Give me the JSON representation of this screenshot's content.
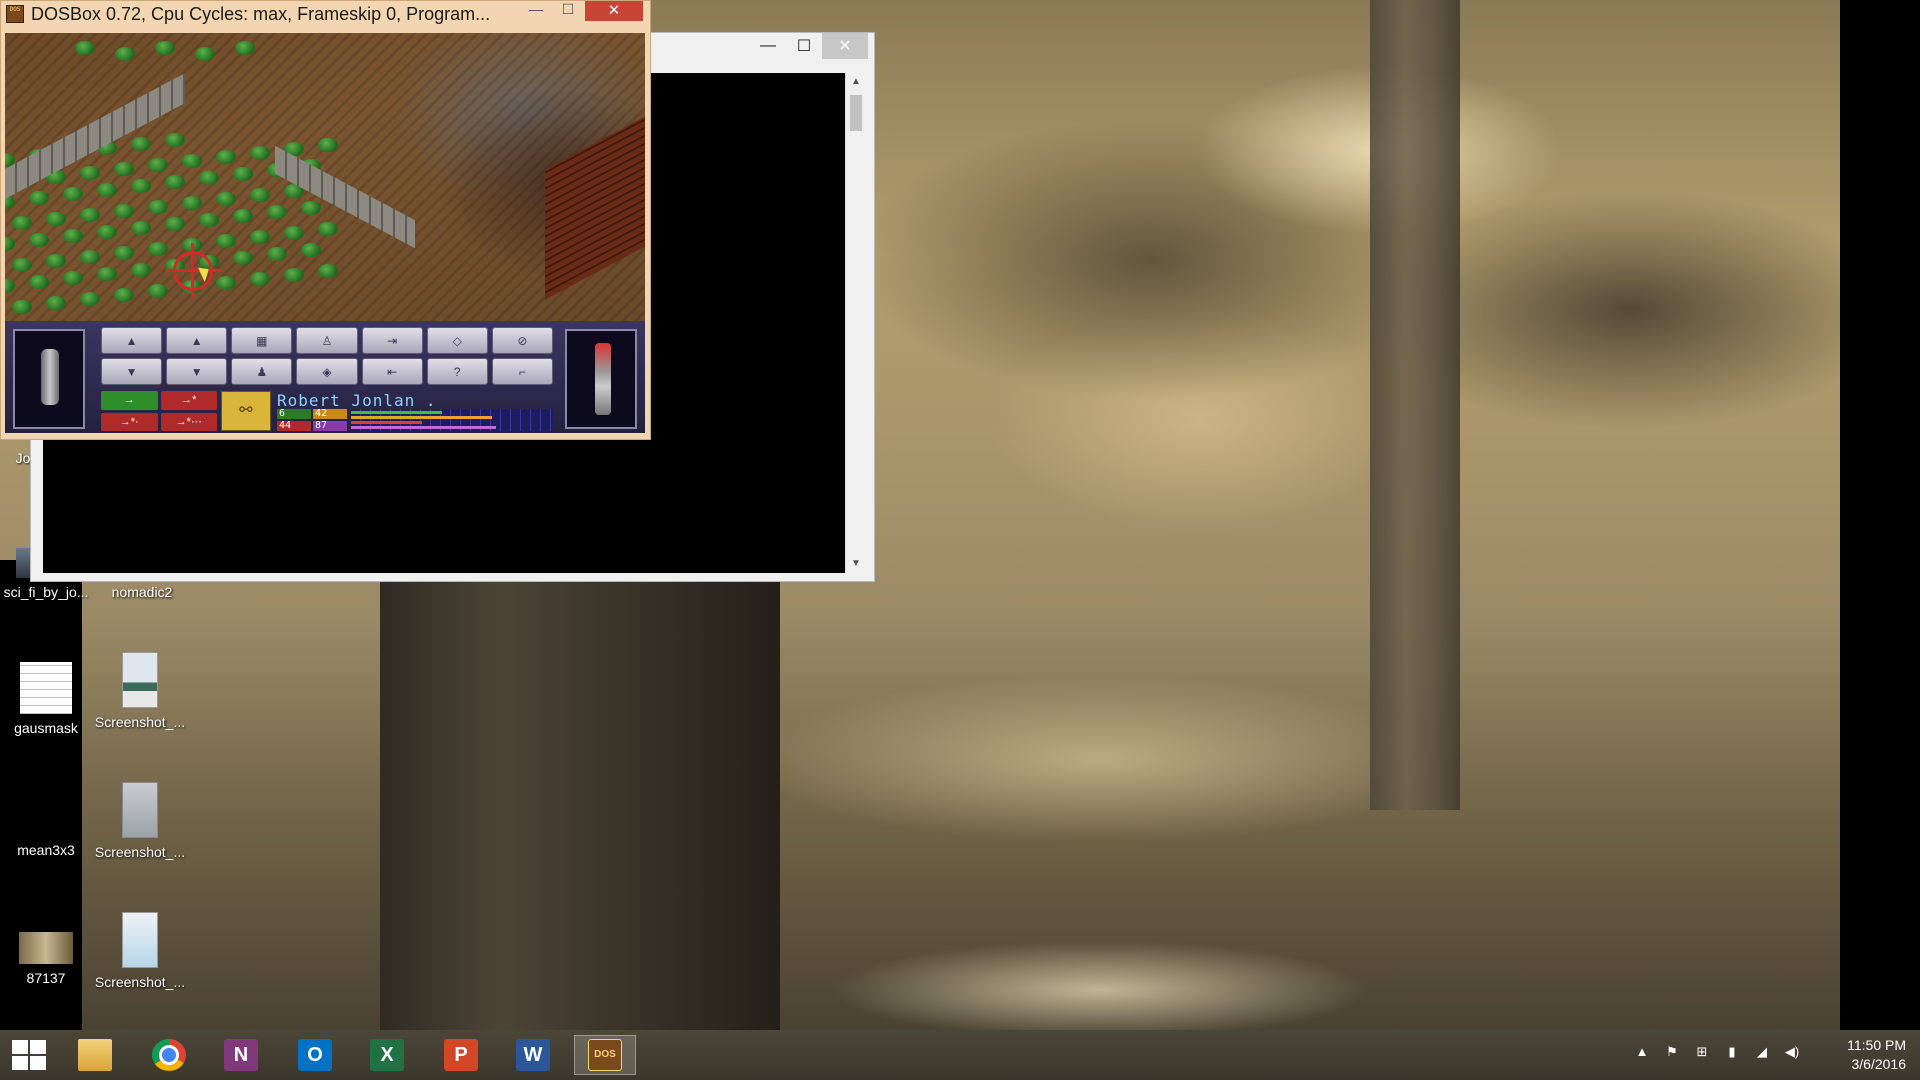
{
  "dosbox": {
    "title": "DOSBox 0.72, Cpu Cycles:      max, Frameskip  0, Program...",
    "app_icon_text": "DOS",
    "minimize_glyph": "—",
    "maximize_glyph": "☐",
    "close_glyph": "✕",
    "game": {
      "soldier_name": "Robert Jonlan .",
      "stats": {
        "time_units": "6",
        "energy": "42",
        "health": "44",
        "morale": "87"
      },
      "stat_fractions": {
        "time_units": 0.45,
        "energy": 0.7,
        "health": 0.35,
        "morale": 0.72
      },
      "hud_buttons": [
        {
          "name": "man-up",
          "glyph": "▲"
        },
        {
          "name": "view-up",
          "glyph": "▲"
        },
        {
          "name": "map",
          "glyph": "▦"
        },
        {
          "name": "kneel",
          "glyph": "♙"
        },
        {
          "name": "next-soldier",
          "glyph": "⇥"
        },
        {
          "name": "view-level",
          "glyph": "◇"
        },
        {
          "name": "options",
          "glyph": "⊘"
        },
        {
          "name": "man-down",
          "glyph": "▼"
        },
        {
          "name": "view-down",
          "glyph": "▼"
        },
        {
          "name": "inventory",
          "glyph": "♟"
        },
        {
          "name": "center",
          "glyph": "◈"
        },
        {
          "name": "next-done",
          "glyph": "⇤"
        },
        {
          "name": "help",
          "glyph": "?"
        },
        {
          "name": "end-turn",
          "glyph": "⌐"
        }
      ],
      "stance_buttons": [
        {
          "name": "reserve-none",
          "glyph": "→",
          "color": "green"
        },
        {
          "name": "reserve-snap",
          "glyph": "→*",
          "color": "red"
        },
        {
          "name": "reserve-aimed",
          "glyph": "→*·",
          "color": "red"
        },
        {
          "name": "reserve-auto",
          "glyph": "→*⋯",
          "color": "red"
        }
      ],
      "reserve_kneel_glyph": "⚯"
    }
  },
  "console": {
    "minimize_glyph": "—",
    "maximize_glyph": "☐",
    "close_glyph": "✕",
    "scroll_up_glyph": "▲",
    "scroll_down_glyph": "▼"
  },
  "desktop_icons": [
    {
      "id": "jo",
      "label": "Jo",
      "icon": "file-icon"
    },
    {
      "id": "scifi",
      "label": "sci_fi_by_jo...",
      "icon": "image-icon"
    },
    {
      "id": "nomadic2",
      "label": "nomadic2",
      "icon": "image-icon"
    },
    {
      "id": "gausmask",
      "label": "gausmask",
      "icon": "spreadsheet-icon"
    },
    {
      "id": "screenshot1",
      "label": "Screenshot_...",
      "icon": "image-icon"
    },
    {
      "id": "mean3x3",
      "label": "mean3x3",
      "icon": "spreadsheet-icon"
    },
    {
      "id": "screenshot2",
      "label": "Screenshot_...",
      "icon": "image-icon"
    },
    {
      "id": "87137",
      "label": "87137",
      "icon": "image-icon"
    },
    {
      "id": "screenshot3",
      "label": "Screenshot_...",
      "icon": "image-icon"
    }
  ],
  "taskbar": {
    "apps": [
      {
        "id": "explorer",
        "name": "File Explorer",
        "glyph": ""
      },
      {
        "id": "chrome",
        "name": "Google Chrome",
        "glyph": ""
      },
      {
        "id": "onenote",
        "name": "OneNote",
        "glyph": "N"
      },
      {
        "id": "outlook",
        "name": "Outlook",
        "glyph": "O"
      },
      {
        "id": "excel",
        "name": "Excel",
        "glyph": "X"
      },
      {
        "id": "powerpoint",
        "name": "PowerPoint",
        "glyph": "P"
      },
      {
        "id": "word",
        "name": "Word",
        "glyph": "W"
      },
      {
        "id": "dosbox",
        "name": "DOSBox",
        "glyph": "DOS"
      }
    ],
    "tray": {
      "show_hidden_glyph": "▲",
      "flag_glyph": "⚑",
      "windows_glyph": "⊞",
      "network_glyph": "▮",
      "signal_glyph": "◢",
      "volume_glyph": "◀)"
    },
    "clock": {
      "time": "11:50 PM",
      "date": "3/6/2016"
    }
  }
}
